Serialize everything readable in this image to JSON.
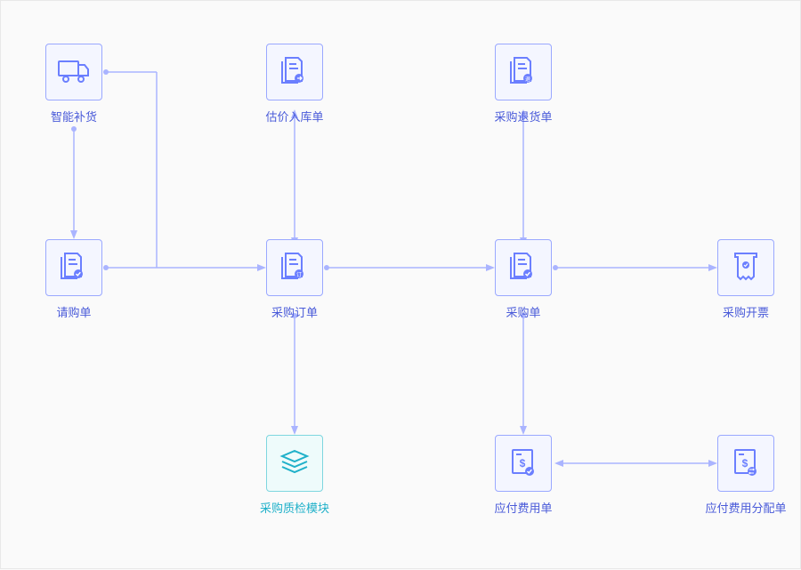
{
  "nodes": {
    "smart_replenish": {
      "label": "智能补货",
      "icon": "truck"
    },
    "request": {
      "label": "请购单",
      "icon": "doc-check"
    },
    "estimate_in": {
      "label": "估价入库单",
      "icon": "doc-arrow"
    },
    "purchase_order": {
      "label": "采购订单",
      "icon": "doc-order"
    },
    "quality_check": {
      "label": "采购质检模块",
      "icon": "layers",
      "variant": "teal"
    },
    "return": {
      "label": "采购退货单",
      "icon": "doc-return"
    },
    "purchase": {
      "label": "采购单",
      "icon": "doc-check"
    },
    "invoice": {
      "label": "采购开票",
      "icon": "invoice"
    },
    "payable": {
      "label": "应付费用单",
      "icon": "doc-money"
    },
    "payable_alloc": {
      "label": "应付费用分配单",
      "icon": "doc-money-swap"
    }
  }
}
